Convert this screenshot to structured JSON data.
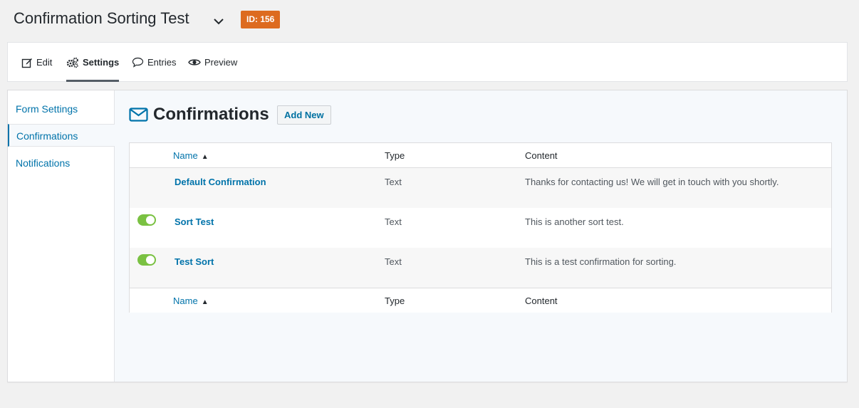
{
  "header": {
    "form_title": "Confirmation Sorting Test",
    "id_badge": "ID: 156"
  },
  "toolbar": {
    "items": [
      {
        "label": "Edit",
        "icon": "edit-icon"
      },
      {
        "label": "Settings",
        "icon": "gears-icon",
        "active": true
      },
      {
        "label": "Entries",
        "icon": "comment-icon"
      },
      {
        "label": "Preview",
        "icon": "eye-icon"
      }
    ]
  },
  "sidebar": {
    "items": [
      {
        "label": "Form Settings"
      },
      {
        "label": "Confirmations",
        "active": true
      },
      {
        "label": "Notifications"
      }
    ]
  },
  "main": {
    "title": "Confirmations",
    "add_new_label": "Add New",
    "columns": {
      "name": "Name",
      "type": "Type",
      "content": "Content"
    },
    "rows": [
      {
        "name": "Default Confirmation",
        "type": "Text",
        "content": "Thanks for contacting us! We will get in touch with you shortly.",
        "toggle": null
      },
      {
        "name": "Sort Test",
        "type": "Text",
        "content": "This is another sort test.",
        "toggle": true
      },
      {
        "name": "Test Sort",
        "type": "Text",
        "content": "This is a test confirmation for sorting.",
        "toggle": true
      }
    ]
  },
  "colors": {
    "badge": "#dd6b20",
    "link": "#0073aa",
    "toggle_on": "#7ac142"
  }
}
